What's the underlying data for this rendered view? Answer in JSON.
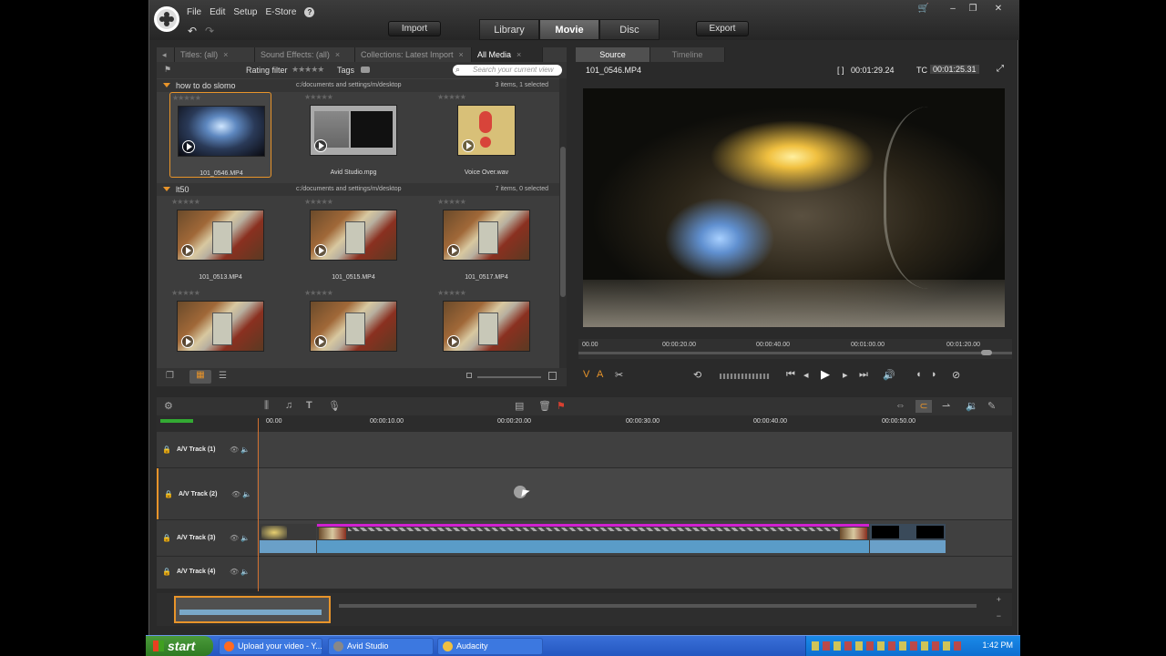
{
  "menu": {
    "file": "File",
    "edit": "Edit",
    "setup": "Setup",
    "estore": "E-Store",
    "help": "?"
  },
  "toolbar": {
    "import": "Import",
    "export": "Export"
  },
  "tabs": [
    {
      "label": "Library"
    },
    {
      "label": "Movie"
    },
    {
      "label": "Disc"
    }
  ],
  "library": {
    "tabs": [
      {
        "label": "Titles: (all)"
      },
      {
        "label": "Sound Effects: (all)"
      },
      {
        "label": "Collections: Latest Import"
      },
      {
        "label": "All Media"
      }
    ],
    "rating_filter": "Rating filter",
    "tags": "Tags",
    "search_placeholder": "Search your current view",
    "sections": [
      {
        "name": "how to do slomo",
        "path": "c:/documents and settings/m/desktop",
        "count": "3 items, 1 selected",
        "items": [
          {
            "caption": "101_0546.MP4"
          },
          {
            "caption": "Avid Studio.mpg"
          },
          {
            "caption": "Voice Over.wav"
          }
        ]
      },
      {
        "name": "lt50",
        "path": "c:/documents and settings/m/desktop",
        "count": "7 items, 0 selected",
        "items": [
          {
            "caption": "101_0513.MP4"
          },
          {
            "caption": "101_0515.MP4"
          },
          {
            "caption": "101_0517.MP4"
          },
          {
            "caption": ""
          },
          {
            "caption": ""
          },
          {
            "caption": ""
          }
        ]
      }
    ]
  },
  "player": {
    "tabs": [
      {
        "label": "Source"
      },
      {
        "label": "Timeline"
      }
    ],
    "filename": "101_0546.MP4",
    "duration": "00:01:29.24",
    "tc_label": "TC",
    "timecode": "00:01:25.31",
    "ruler": [
      "00.00",
      "00:00:20.00",
      "00:00:40.00",
      "00:01:00.00",
      "00:01:20.00"
    ],
    "progress": 0.96
  },
  "timeline": {
    "ruler": [
      "00.00",
      "00:00:10.00",
      "00:00:20.00",
      "00:00:30.00",
      "00:00:40.00",
      "00:00:50.00"
    ],
    "tracks": [
      {
        "name": "A/V Track (1)"
      },
      {
        "name": "A/V Track (2)"
      },
      {
        "name": "A/V Track (3)"
      },
      {
        "name": "A/V Track (4)"
      }
    ]
  },
  "taskbar": {
    "start": "start",
    "tasks": [
      {
        "label": "Upload your video - Y..."
      },
      {
        "label": "Avid Studio"
      },
      {
        "label": "Audacity"
      }
    ],
    "clock": "1:42 PM"
  },
  "colors": {
    "accent": "#e8942a",
    "clip_magenta": "#d020d0",
    "clip_blue": "#6aa0c8"
  }
}
